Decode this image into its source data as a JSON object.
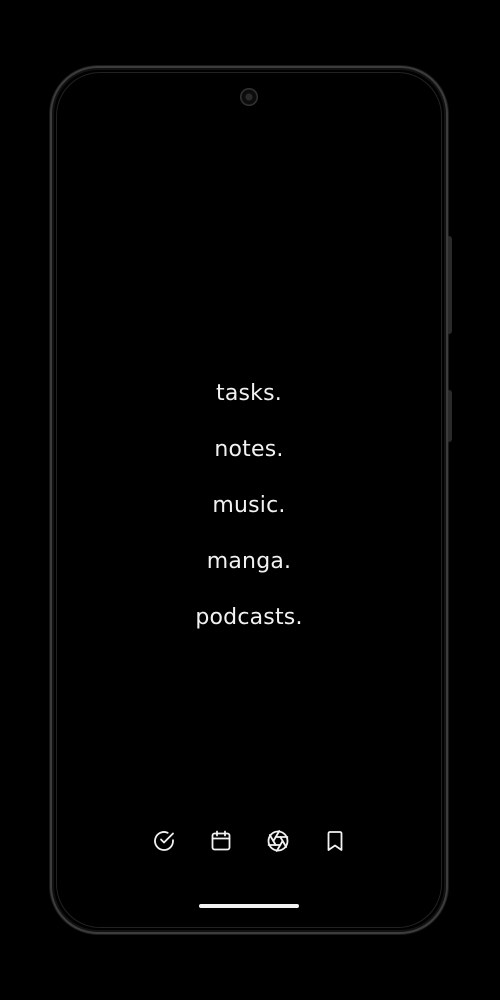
{
  "menu": {
    "items": [
      {
        "label": "tasks."
      },
      {
        "label": "notes."
      },
      {
        "label": "music."
      },
      {
        "label": "manga."
      },
      {
        "label": "podcasts."
      }
    ]
  },
  "tabbar": {
    "icons": [
      "check-circle-icon",
      "calendar-icon",
      "aperture-icon",
      "bookmark-icon"
    ]
  },
  "colors": {
    "background": "#000000",
    "foreground": "#f2f2f2",
    "bezel": "#3c3c3c"
  }
}
